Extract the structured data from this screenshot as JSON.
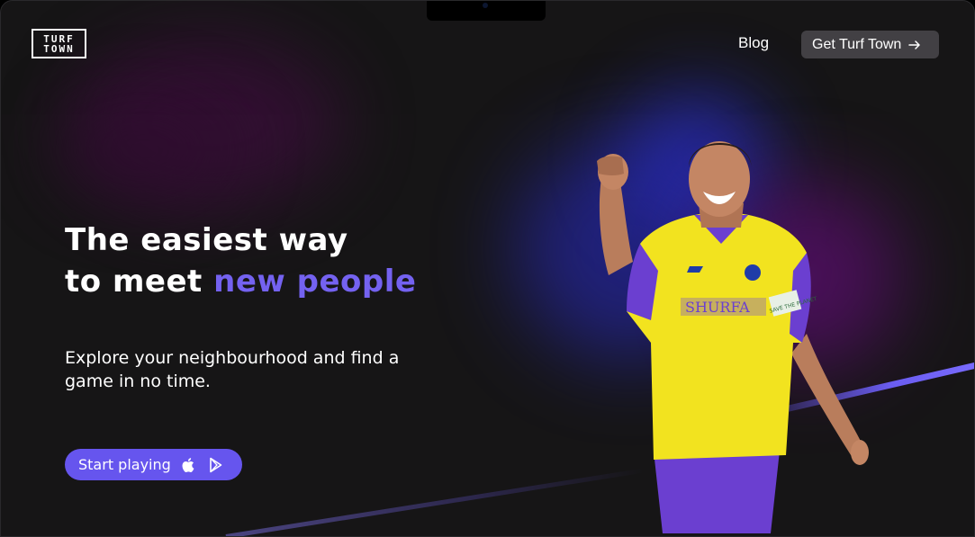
{
  "brand": {
    "logo_line1": "TURF",
    "logo_line2": "TOWN"
  },
  "nav": {
    "blog_label": "Blog",
    "cta_label": "Get Turf Town"
  },
  "hero": {
    "headline_line1": "The easiest way",
    "headline_line2_prefix": "to",
    "headline_line2_bold": "meet",
    "headline_line2_accent": "new people",
    "subtitle": "Explore your neighbourhood and find a game in no time.",
    "cta_label": "Start playing",
    "player_image": {
      "jersey_sponsor": "SHURFA",
      "armband_text": "SAVE THE PLANET"
    }
  },
  "colors": {
    "background": "#161516",
    "accent": "#6655ee",
    "headline_accent": "#7462f0",
    "nav_button": "#424044",
    "text": "#ffffff"
  },
  "icons": {
    "nav_cta_icon": "arrow-right-icon",
    "store_icons": [
      "apple-icon",
      "google-play-icon"
    ]
  }
}
